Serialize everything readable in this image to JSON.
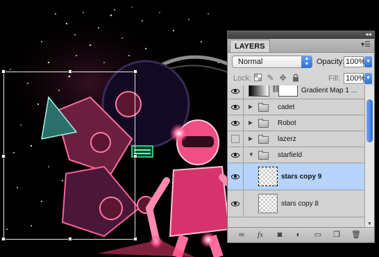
{
  "layers_panel": {
    "tab_label": "LAYERS",
    "blend_mode": "Normal",
    "opacity_label": "Opacity:",
    "opacity_value": "100%",
    "lock_label": "Lock:",
    "fill_label": "Fill:",
    "fill_value": "100%",
    "layers": [
      {
        "name": "Gradient Map 1 ...",
        "type": "adjustment",
        "visible": true
      },
      {
        "name": "cadet",
        "type": "group",
        "visible": true,
        "expanded": false
      },
      {
        "name": "Robot",
        "type": "group",
        "visible": true,
        "expanded": false
      },
      {
        "name": "lazerz",
        "type": "group",
        "visible": false,
        "expanded": false
      },
      {
        "name": "starfield",
        "type": "group",
        "visible": true,
        "expanded": true
      },
      {
        "name": "stars copy 9",
        "type": "pixel",
        "visible": true,
        "selected": true
      },
      {
        "name": "stars copy 8",
        "type": "pixel",
        "visible": true
      }
    ]
  },
  "icons": {
    "lock_transparent": "lock-transparent-icon",
    "lock_paint": "brush-icon",
    "lock_move": "move-icon",
    "lock_all": "padlock-icon",
    "bottom": [
      "link-icon",
      "fx-icon",
      "mask-icon",
      "adjustment-icon",
      "folder-icon",
      "new-layer-icon",
      "trash-icon"
    ]
  },
  "colors": {
    "selection_highlight": "#b5d3fb",
    "panel_bg": "#d6d6d6",
    "accent_blue": "#2f6fd3"
  }
}
